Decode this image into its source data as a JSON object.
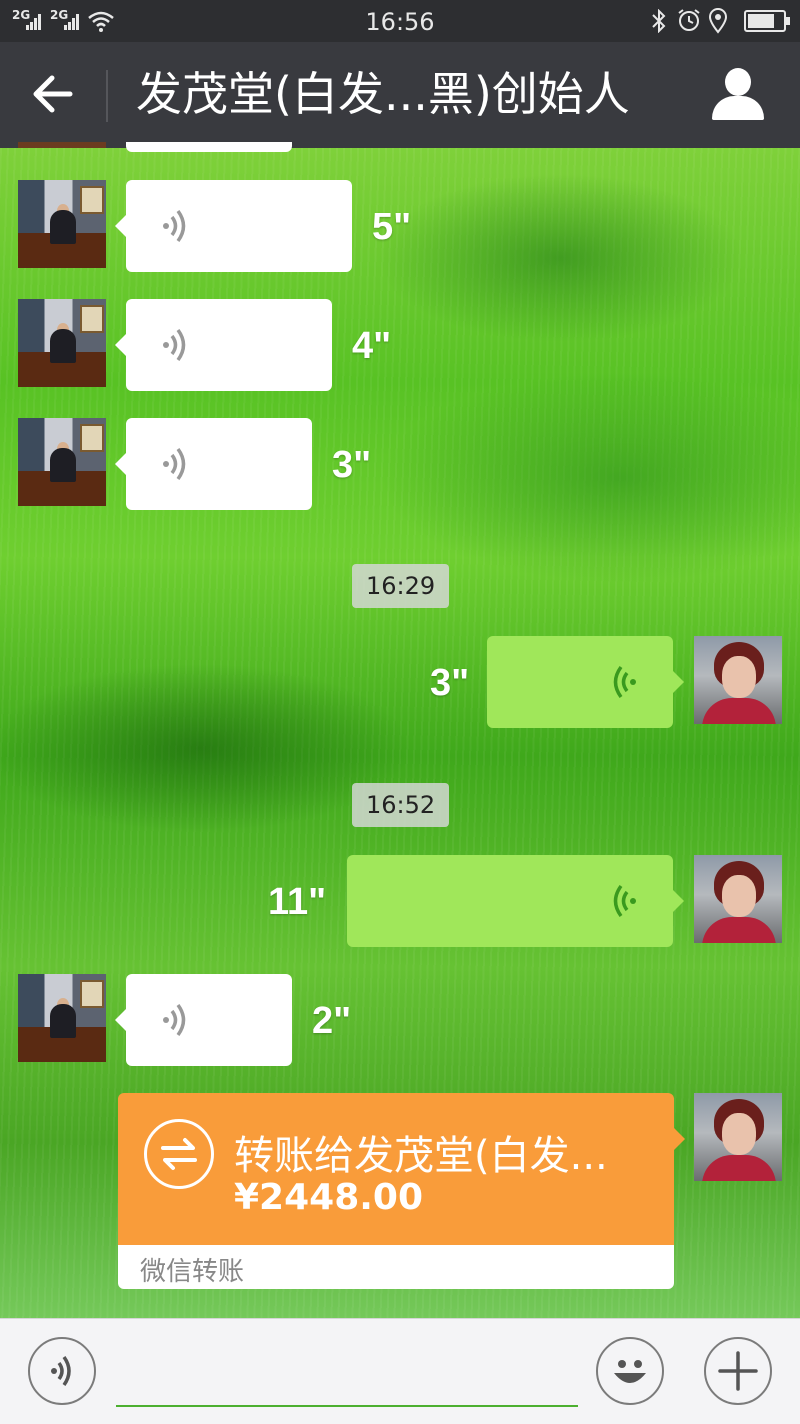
{
  "status_bar": {
    "signal1": "2G",
    "signal2": "2G",
    "time": "16:56",
    "icons": [
      "signal-icon",
      "wifi-icon",
      "bluetooth-icon",
      "alarm-icon",
      "location-icon",
      "battery-icon"
    ],
    "battery_level": 0.75
  },
  "header": {
    "back_icon": "back-arrow-icon",
    "title": "发茂堂(白发...黑)创始人",
    "profile_icon": "person-icon"
  },
  "messages": [
    {
      "type": "voice",
      "side": "left",
      "duration": "5\""
    },
    {
      "type": "voice",
      "side": "left",
      "duration": "4\""
    },
    {
      "type": "voice",
      "side": "left",
      "duration": "3\""
    },
    {
      "type": "timestamp",
      "text": "16:29"
    },
    {
      "type": "voice",
      "side": "right",
      "duration": "3\""
    },
    {
      "type": "timestamp",
      "text": "16:52"
    },
    {
      "type": "voice",
      "side": "right",
      "duration": "11\""
    },
    {
      "type": "voice",
      "side": "left",
      "duration": "2\""
    },
    {
      "type": "transfer",
      "side": "right",
      "title": "转账给发茂堂(白发...",
      "amount": "¥2448.00",
      "footer": "微信转账"
    }
  ],
  "input_bar": {
    "voice_icon": "voice-input-icon",
    "emoji_icon": "emoji-icon",
    "plus_icon": "plus-icon",
    "input_value": ""
  },
  "colors": {
    "header_bg": "#393a3f",
    "status_bg": "#2d2e31",
    "bubble_out": "#a0e75a",
    "bubble_in": "#ffffff",
    "transfer": "#f99c3a",
    "accent_green": "#4caf2f"
  }
}
